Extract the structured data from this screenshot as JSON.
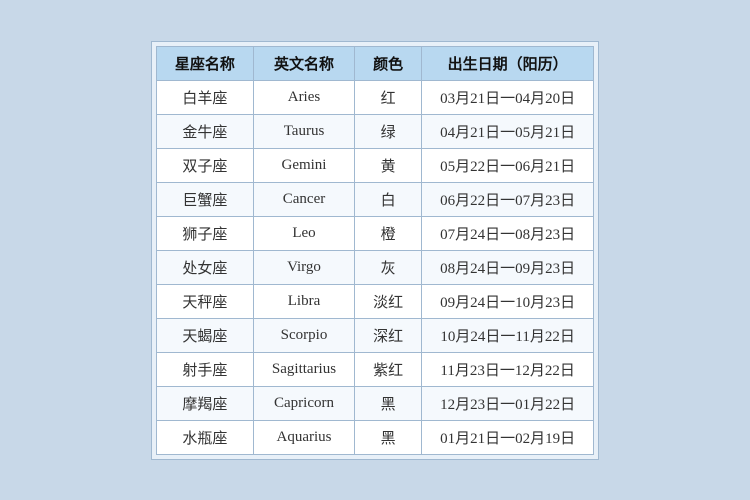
{
  "table": {
    "headers": [
      "星座名称",
      "英文名称",
      "颜色",
      "出生日期（阳历）"
    ],
    "rows": [
      [
        "白羊座",
        "Aries",
        "红",
        "03月21日一04月20日"
      ],
      [
        "金牛座",
        "Taurus",
        "绿",
        "04月21日一05月21日"
      ],
      [
        "双子座",
        "Gemini",
        "黄",
        "05月22日一06月21日"
      ],
      [
        "巨蟹座",
        "Cancer",
        "白",
        "06月22日一07月23日"
      ],
      [
        "狮子座",
        "Leo",
        "橙",
        "07月24日一08月23日"
      ],
      [
        "处女座",
        "Virgo",
        "灰",
        "08月24日一09月23日"
      ],
      [
        "天秤座",
        "Libra",
        "淡红",
        "09月24日一10月23日"
      ],
      [
        "天蝎座",
        "Scorpio",
        "深红",
        "10月24日一11月22日"
      ],
      [
        "射手座",
        "Sagittarius",
        "紫红",
        "11月23日一12月22日"
      ],
      [
        "摩羯座",
        "Capricorn",
        "黑",
        "12月23日一01月22日"
      ],
      [
        "水瓶座",
        "Aquarius",
        "黑",
        "01月21日一02月19日"
      ]
    ]
  }
}
